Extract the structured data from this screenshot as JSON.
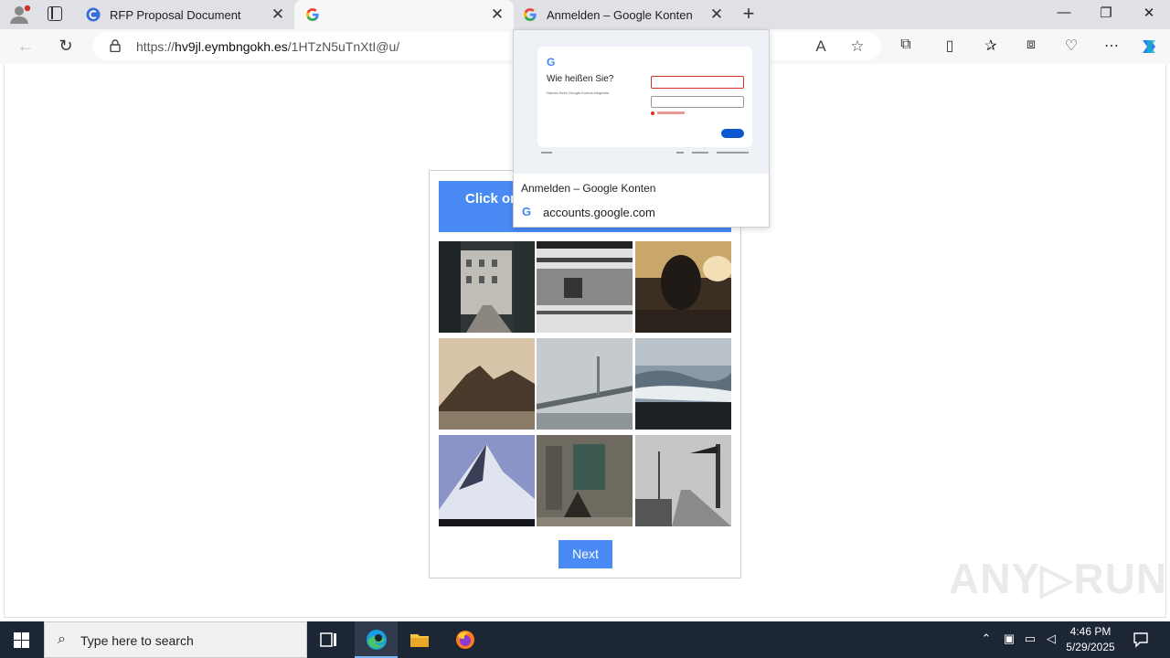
{
  "browser": {
    "tabs": [
      {
        "title": "RFP Proposal Document",
        "icon": "globe-c-icon"
      },
      {
        "title": "",
        "icon": "google-g-icon"
      },
      {
        "title": "Anmelden – Google Konten",
        "icon": "google-g-icon"
      }
    ],
    "close_glyph": "✕",
    "new_tab_glyph": "+",
    "url_host": "hv9jl.eymbngokh.es",
    "url_prefix": "https://",
    "url_path": "/1HTzN5uTnXtI@u/"
  },
  "window_controls": [
    "—",
    "❐",
    "✕"
  ],
  "tab_preview": {
    "title": "Anmelden – Google Konten",
    "domain": "accounts.google.com",
    "preview_heading": "Wie heißen Sie?",
    "preview_sub": "Namen Ihres Google-Kontos eingeben"
  },
  "captcha": {
    "instruction": "Click or",
    "tiles": [
      "street-alley-photo",
      "motion-blur-photo",
      "sunset-person-photo",
      "coastal-cliff-photo",
      "foggy-bridge-photo",
      "ocean-wave-photo",
      "matterhorn-mountain-photo",
      "old-building-photo",
      "pier-lamp-photo"
    ],
    "next_label": "Next"
  },
  "watermark": "ANY▷RUN",
  "taskbar": {
    "search_placeholder": "Type here to search",
    "time": "4:46 PM",
    "date": "5/29/2025"
  },
  "colors": {
    "accent": "#4a8af4",
    "taskbar": "#1c2634"
  }
}
